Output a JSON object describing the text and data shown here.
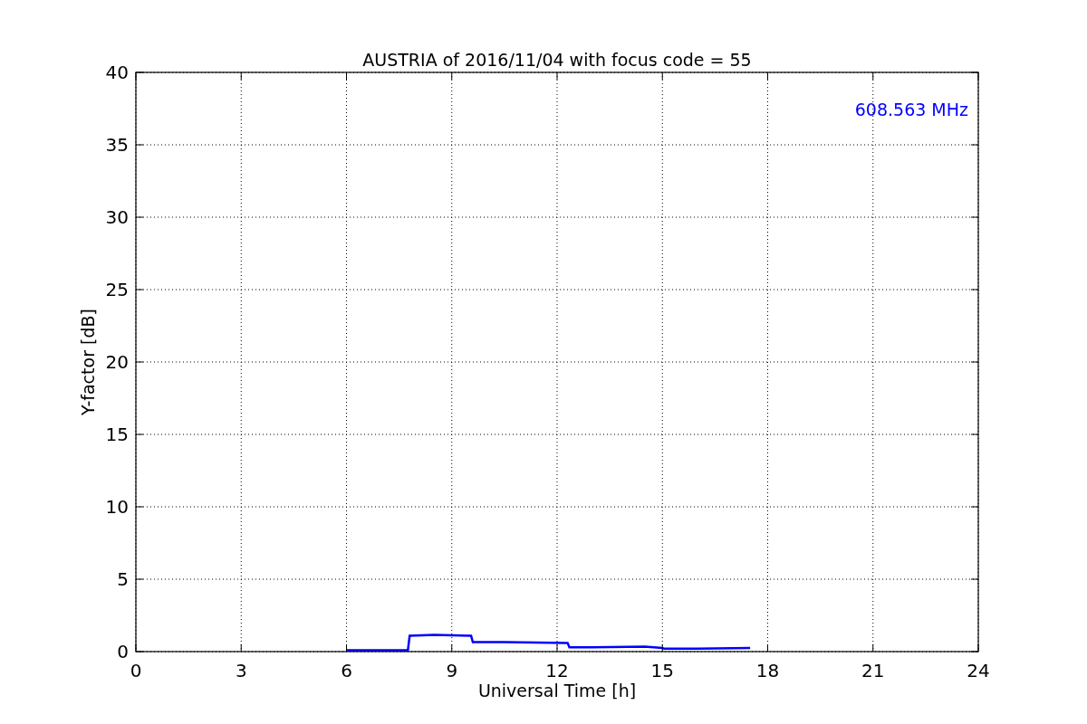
{
  "chart_data": {
    "type": "line",
    "title": "AUSTRIA of 2016/11/04 with focus code = 55",
    "xlabel": "Universal Time [h]",
    "ylabel": "Y-factor [dB]",
    "x": [
      6,
      7.75,
      7.8,
      8.5,
      9.55,
      9.6,
      10.5,
      12.3,
      12.35,
      13,
      14.5,
      15,
      15.05,
      16,
      17.5
    ],
    "series": [
      {
        "name": "608.563 MHz",
        "color": "#0000ff",
        "values": [
          0.1,
          0.1,
          1.1,
          1.15,
          1.1,
          0.65,
          0.65,
          0.6,
          0.3,
          0.3,
          0.35,
          0.25,
          0.2,
          0.2,
          0.25
        ]
      }
    ],
    "xlim": [
      0,
      24
    ],
    "ylim": [
      0,
      40
    ],
    "xticks": [
      0,
      3,
      6,
      9,
      12,
      15,
      18,
      21,
      24
    ],
    "yticks": [
      0,
      5,
      10,
      15,
      20,
      25,
      30,
      35,
      40
    ],
    "grid": true
  }
}
